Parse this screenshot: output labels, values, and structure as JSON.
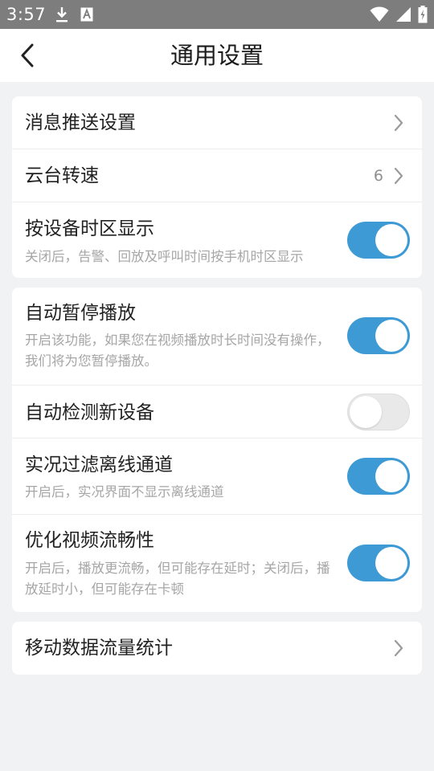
{
  "status_bar": {
    "time": "3:57",
    "left_icons": [
      "download-icon",
      "font-app-icon"
    ],
    "right_icons": [
      "wifi-icon",
      "cell-signal-icon",
      "battery-charging-icon"
    ]
  },
  "header": {
    "title": "通用设置",
    "back_icon": "chevron-left-icon"
  },
  "groups": [
    {
      "items": [
        {
          "title": "消息推送设置",
          "type": "link"
        },
        {
          "title": "云台转速",
          "type": "link",
          "value": "6"
        },
        {
          "title": "按设备时区显示",
          "subtitle": "关闭后，告警、回放及呼叫时间按手机时区显示",
          "type": "toggle",
          "state": "on"
        }
      ]
    },
    {
      "items": [
        {
          "title": "自动暂停播放",
          "subtitle": "开启该功能，如果您在视频播放时长时间没有操作，我们将为您暂停播放。",
          "type": "toggle",
          "state": "on"
        },
        {
          "title": "自动检测新设备",
          "type": "toggle",
          "state": "off"
        },
        {
          "title": "实况过滤离线通道",
          "subtitle": "开启后，实况界面不显示离线通道",
          "type": "toggle",
          "state": "on"
        },
        {
          "title": "优化视频流畅性",
          "subtitle": "开启后，播放更流畅，但可能存在延时；关闭后，播放延时小，但可能存在卡顿",
          "type": "toggle",
          "state": "on"
        }
      ]
    },
    {
      "items": [
        {
          "title": "移动数据流量统计",
          "type": "link"
        }
      ]
    }
  ],
  "colors": {
    "accent": "#3d9ad5",
    "background": "#f1f2f4",
    "status_bar": "#7d7d7d",
    "subtitle_text": "#a6a6a6"
  }
}
